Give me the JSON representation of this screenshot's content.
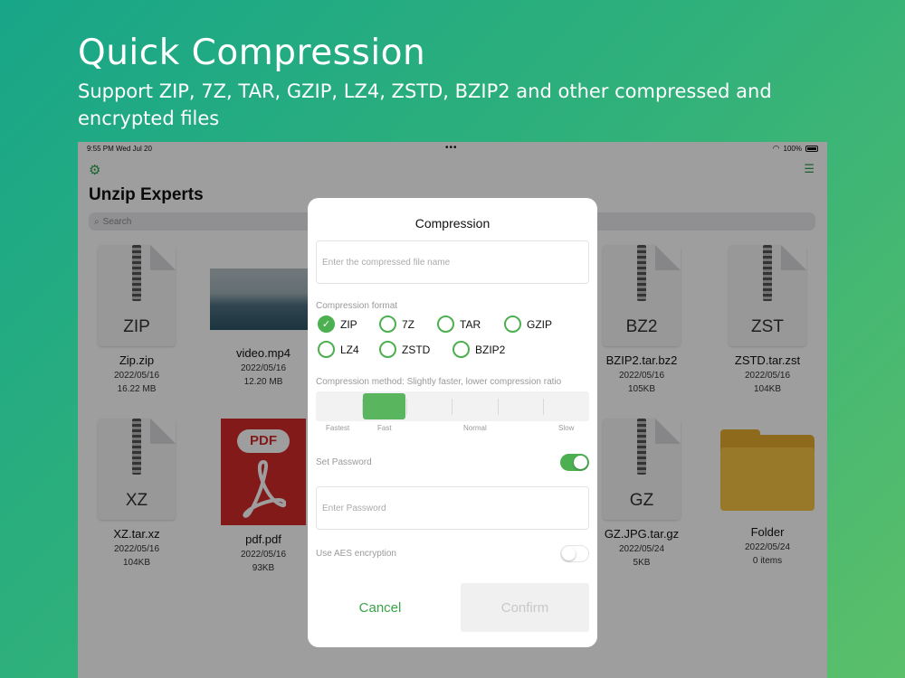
{
  "promo": {
    "title": "Quick Compression",
    "subtitle": "Support ZIP, 7Z, TAR, GZIP, LZ4, ZSTD, BZIP2 and other compressed and encrypted files"
  },
  "statusbar": {
    "time": "9:55 PM  Wed Jul 20",
    "battery": "100%"
  },
  "app": {
    "title": "Unzip Experts",
    "search_placeholder": "Search"
  },
  "files": [
    {
      "type": "archive",
      "ext": "ZIP",
      "name": "Zip.zip",
      "date": "2022/05/16",
      "size": "16.22 MB"
    },
    {
      "type": "image",
      "name": "video.mp4",
      "date": "2022/05/16",
      "size": "12.20 MB"
    },
    {
      "type": "archive",
      "ext": "BZ2",
      "name": "BZIP2.tar.bz2",
      "date": "2022/05/16",
      "size": "105KB"
    },
    {
      "type": "archive",
      "ext": "ZST",
      "name": "ZSTD.tar.zst",
      "date": "2022/05/16",
      "size": "104KB"
    },
    {
      "type": "archive",
      "ext": "XZ",
      "name": "XZ.tar.xz",
      "date": "2022/05/16",
      "size": "104KB"
    },
    {
      "type": "pdf",
      "ext": "PDF",
      "name": "pdf.pdf",
      "date": "2022/05/16",
      "size": "93KB"
    },
    {
      "type": "archive",
      "ext": "GZ",
      "name": "GZ.JPG.tar.gz",
      "date": "2022/05/24",
      "size": "5KB"
    },
    {
      "type": "folder",
      "name": "Folder",
      "date": "2022/05/24",
      "size": "0 items"
    }
  ],
  "dialog": {
    "title": "Compression",
    "filename_placeholder": "Enter the compressed file name",
    "format_label": "Compression format",
    "formats": [
      "ZIP",
      "7Z",
      "TAR",
      "GZIP",
      "LZ4",
      "ZSTD",
      "BZIP2"
    ],
    "selected_format": "ZIP",
    "method_label": "Compression method: Slightly faster, lower compression ratio",
    "method_levels": [
      "Fastest",
      "Fast",
      "Normal",
      "Slow"
    ],
    "selected_method": "Fast",
    "password_label": "Set Password",
    "password_enabled": true,
    "password_placeholder": "Enter Password",
    "aes_label": "Use AES encryption",
    "aes_enabled": false,
    "cancel_label": "Cancel",
    "confirm_label": "Confirm"
  },
  "colors": {
    "accent": "#4caf50",
    "pdf_red": "#d42a2a",
    "folder": "#f5c243"
  }
}
